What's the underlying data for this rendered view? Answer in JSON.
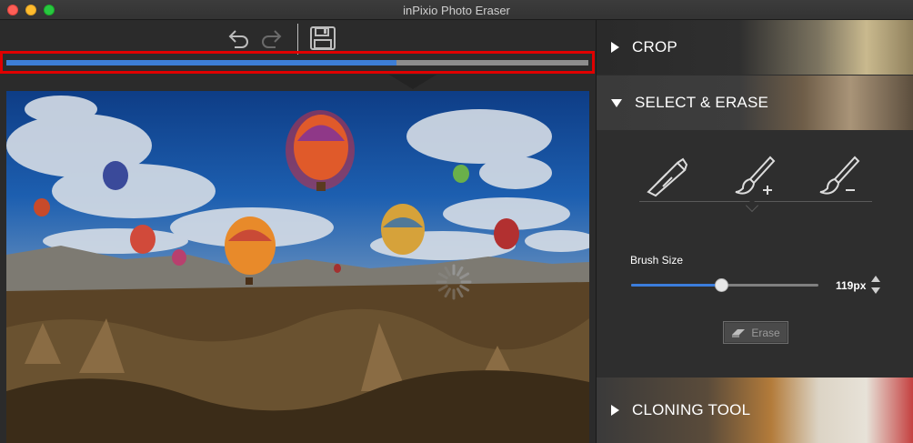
{
  "window": {
    "title": "inPixio Photo Eraser"
  },
  "toolbar": {
    "undo_icon": "undo-arrow-icon",
    "redo_icon": "redo-arrow-icon",
    "save_icon": "floppy-disk-icon"
  },
  "progress": {
    "value_percent": 67,
    "accent": "#3d7ed6",
    "highlight": "#e00000"
  },
  "panel": {
    "crop": {
      "label": "CROP"
    },
    "select_erase": {
      "label": "SELECT & ERASE",
      "tools": [
        "cutter-icon",
        "brush-plus-icon",
        "brush-minus-icon"
      ],
      "brush_size_label": "Brush Size",
      "brush_size_value": "119px",
      "brush_size_fraction": 0.48,
      "erase_label": "Erase"
    },
    "cloning": {
      "label": "CLONING TOOL"
    }
  }
}
